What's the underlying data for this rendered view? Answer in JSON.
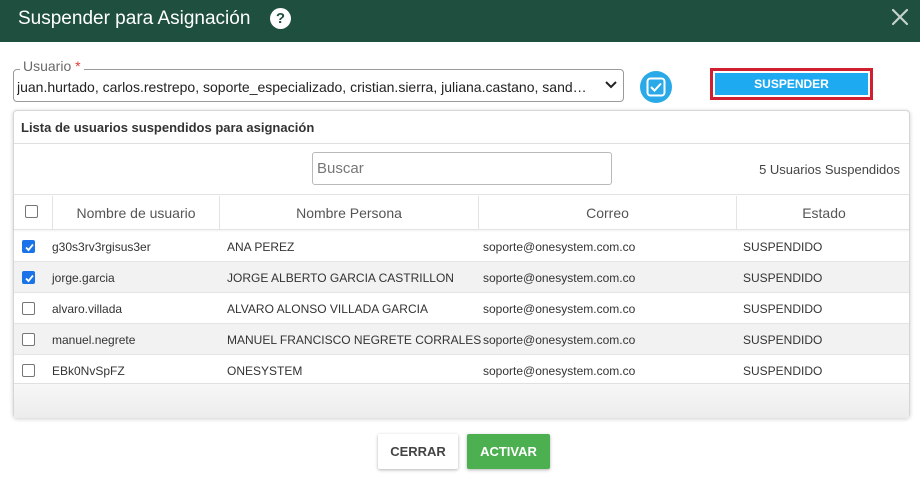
{
  "dialog": {
    "title": "Suspender para Asignación",
    "help_icon": "help-circle-icon",
    "close_icon": "close-icon"
  },
  "user_select": {
    "label": "Usuario",
    "required_mark": "*",
    "value": "juan.hurtado, carlos.restrepo, soporte_especializado, cristian.sierra, juliana.castano, sandra.marin"
  },
  "suspend_button": {
    "label": "SUSPENDER"
  },
  "panel": {
    "title": "Lista de usuarios suspendidos para asignación",
    "search_placeholder": "Buscar",
    "count_text": "5 Usuarios Suspendidos",
    "columns": [
      "Nombre de usuario",
      "Nombre Persona",
      "Correo",
      "Estado"
    ],
    "select_all_checked": false,
    "rows": [
      {
        "checked": true,
        "username": "g30s3rv3rgisus3er",
        "person": "ANA PEREZ",
        "email": "soporte@onesystem.com.co",
        "status": "SUSPENDIDO"
      },
      {
        "checked": true,
        "username": "jorge.garcia",
        "person": "JORGE ALBERTO GARCIA CASTRILLON",
        "email": "soporte@onesystem.com.co",
        "status": "SUSPENDIDO"
      },
      {
        "checked": false,
        "username": "alvaro.villada",
        "person": "ALVARO ALONSO VILLADA GARCIA",
        "email": "soporte@onesystem.com.co",
        "status": "SUSPENDIDO"
      },
      {
        "checked": false,
        "username": "manuel.negrete",
        "person": "MANUEL FRANCISCO NEGRETE CORRALES",
        "email": "soporte@onesystem.com.co",
        "status": "SUSPENDIDO"
      },
      {
        "checked": false,
        "username": "EBk0NvSpFZ",
        "person": "ONESYSTEM",
        "email": "soporte@onesystem.com.co",
        "status": "SUSPENDIDO"
      }
    ]
  },
  "footer": {
    "close_label": "CERRAR",
    "activate_label": "ACTIVAR"
  },
  "colors": {
    "titlebar": "#1f4f3f",
    "primary": "#1eaaf1",
    "highlight_outline": "#d21f2f",
    "success": "#4caf50",
    "checkbox_checked": "#1a73e8"
  }
}
